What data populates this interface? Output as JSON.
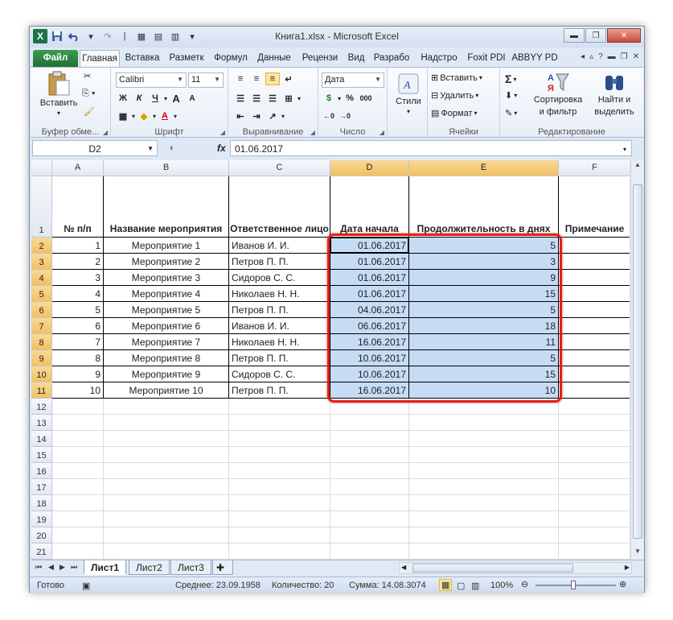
{
  "window": {
    "title": "Книга1.xlsx - Microsoft Excel",
    "qat": {
      "excel_icon": "excel-icon",
      "save": "save-icon",
      "undo": "undo-icon",
      "redo": "redo-icon"
    }
  },
  "tabs": [
    "Файл",
    "Главная",
    "Вставка",
    "Разметк",
    "Формул",
    "Данные",
    "Рецензи",
    "Вид",
    "Разрабо",
    "Надстро",
    "Foxit PDI",
    "ABBYY PD"
  ],
  "ribbon": {
    "clipboard": {
      "paste_label": "Вставить",
      "group_label": "Буфер обме..."
    },
    "font": {
      "font_name": "Calibri",
      "font_size": "11",
      "bold": "Ж",
      "italic": "К",
      "underline": "Ч",
      "grow": "A",
      "shrink": "A",
      "group_label": "Шрифт"
    },
    "alignment": {
      "group_label": "Выравнивание"
    },
    "number": {
      "format": "Дата",
      "percent": "%",
      "thousands": "000",
      "group_label": "Число"
    },
    "styles": {
      "label": "Стили"
    },
    "cells": {
      "insert": "Вставить",
      "delete": "Удалить",
      "format": "Формат",
      "group_label": "Ячейки"
    },
    "editing": {
      "sort_line1": "Сортировка",
      "sort_line2": "и фильтр",
      "find_line1": "Найти и",
      "find_line2": "выделить",
      "sigma": "Σ",
      "group_label": "Редактирование"
    }
  },
  "formula_bar": {
    "name_box": "D2",
    "fx": "fx",
    "value": "01.06.2017"
  },
  "grid": {
    "columns": [
      "A",
      "B",
      "C",
      "D",
      "E",
      "F"
    ],
    "headers": [
      "№ п/п",
      "Название мероприятия",
      "Ответственное лицо",
      "Дата начала",
      "Продолжительность в днях",
      "Примечание"
    ],
    "rows": [
      [
        "1",
        "Мероприятие 1",
        "Иванов И. И.",
        "01.06.2017",
        "5",
        ""
      ],
      [
        "2",
        "Мероприятие 2",
        "Петров П. П.",
        "01.06.2017",
        "3",
        ""
      ],
      [
        "3",
        "Мероприятие 3",
        "Сидоров С. С.",
        "01.06.2017",
        "9",
        ""
      ],
      [
        "4",
        "Мероприятие 4",
        "Николаев Н. Н.",
        "01.06.2017",
        "15",
        ""
      ],
      [
        "5",
        "Мероприятие 5",
        "Петров П. П.",
        "04.06.2017",
        "5",
        ""
      ],
      [
        "6",
        "Мероприятие 6",
        "Иванов И. И.",
        "06.06.2017",
        "18",
        ""
      ],
      [
        "7",
        "Мероприятие 7",
        "Николаев Н. Н.",
        "16.06.2017",
        "11",
        ""
      ],
      [
        "8",
        "Мероприятие 8",
        "Петров П. П.",
        "10.06.2017",
        "5",
        ""
      ],
      [
        "9",
        "Мероприятие 9",
        "Сидоров С. С.",
        "10.06.2017",
        "15",
        ""
      ],
      [
        "10",
        "Мероприятие 10",
        "Петров П. П.",
        "16.06.2017",
        "10",
        ""
      ]
    ],
    "row_numbers": [
      "1",
      "2",
      "3",
      "4",
      "5",
      "6",
      "7",
      "8",
      "9",
      "10",
      "11",
      "12",
      "13",
      "14",
      "15",
      "16",
      "17",
      "18",
      "19",
      "20",
      "21"
    ]
  },
  "sheets": [
    "Лист1",
    "Лист2",
    "Лист3"
  ],
  "status": {
    "ready": "Готово",
    "average": "Среднее: 23.09.1958",
    "count": "Количество: 20",
    "sum": "Сумма: 14.08.3074",
    "zoom": "100%"
  },
  "colors": {
    "selection": "#c6dcf5",
    "highlight_border": "#e0201b",
    "file_tab": "#1d6e31"
  }
}
